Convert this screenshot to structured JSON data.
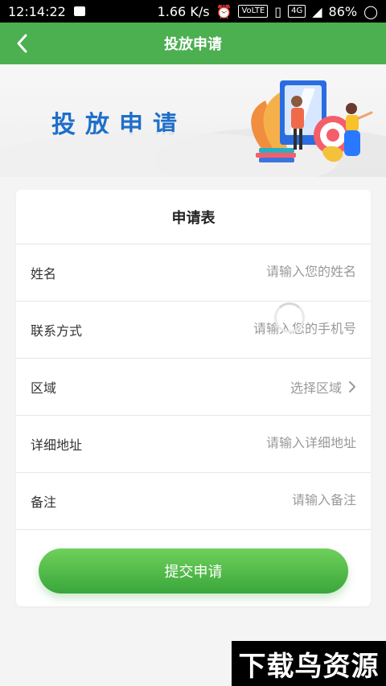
{
  "status_bar": {
    "time": "12:14:22",
    "speed": "1.66 K/s",
    "volte": "VoLTE",
    "network": "4G",
    "battery": "86%"
  },
  "nav": {
    "title": "投放申请"
  },
  "banner": {
    "title": "投放申请"
  },
  "form": {
    "title": "申请表",
    "fields": [
      {
        "label": "姓名",
        "placeholder": "请输入您的姓名"
      },
      {
        "label": "联系方式",
        "placeholder": "请输入您的手机号"
      },
      {
        "label": "区域",
        "value": "选择区域"
      },
      {
        "label": "详细地址",
        "placeholder": "请输入详细地址"
      },
      {
        "label": "备注",
        "placeholder": "请输入备注"
      }
    ],
    "submit_label": "提交申请"
  },
  "watermark": {
    "text": "下载鸟资源"
  },
  "colors": {
    "accent": "#4caf50",
    "banner_title": "#1f6fc9",
    "button_start": "#6fd05b",
    "button_end": "#3aa63b"
  }
}
